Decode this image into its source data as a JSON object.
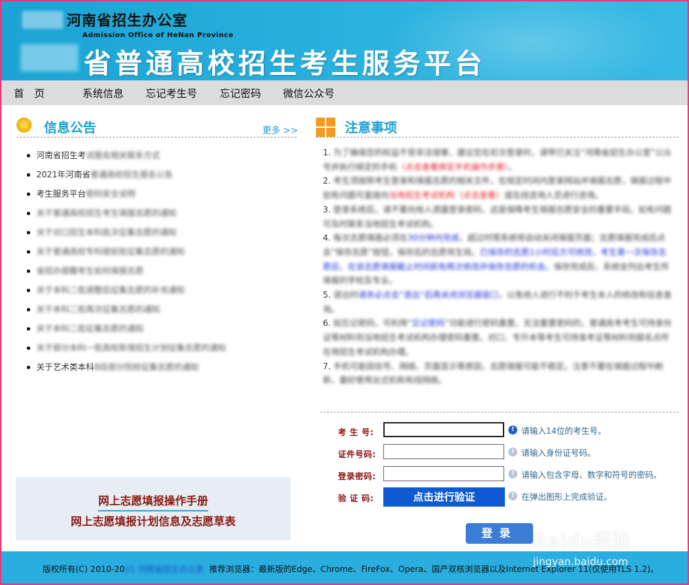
{
  "header": {
    "office_name": "河南省招生办公室",
    "office_name_en": "Admission Office of HeNan Province",
    "platform_title": "省普通高校招生考生服务平台"
  },
  "nav": [
    "首　页",
    "系统信息",
    "忘记考生号",
    "忘记密码",
    "微信公众号"
  ],
  "left": {
    "title": "信息公告",
    "more": "更多 >>",
    "news": [
      {
        "clear": "河南省招生考",
        "blur": "试报名相关联系方式"
      },
      {
        "clear": "2021年河南省",
        "blur": "普通高校招生报名公告"
      },
      {
        "clear": "考生服务平台",
        "blur": "密码安全说明"
      },
      {
        "clear": "",
        "blur": "关于普通高校招生考生填报志愿的通知"
      },
      {
        "clear": "",
        "blur": "关于对口招生本科批次征集志愿的通知"
      },
      {
        "clear": "",
        "blur": "关于普通高校专科提前批征集志愿的通知"
      },
      {
        "clear": "",
        "blur": "省招办提醒考生如何填报志愿"
      },
      {
        "clear": "",
        "blur": "关于本科二批调整后征集志愿的补充通知"
      },
      {
        "clear": "",
        "blur": "关于本科二批再次征集志愿的通知"
      },
      {
        "clear": "",
        "blur": "关于本科二批征集志愿的通知"
      },
      {
        "clear": "",
        "blur": "关于部分本科一批高校新增招生计划征集志愿的通知"
      },
      {
        "clear": "关于艺术类本科",
        "blur": "B段部分院校征集志愿的通知"
      }
    ],
    "manual_link": "网上志愿填报操作手册",
    "plan_link": "网上志愿填报计划信息及志愿草表"
  },
  "right": {
    "title": "注意事项",
    "notes": [
      [
        {
          "c": "1. ",
          "t": "p"
        },
        {
          "c": "为了确保您的权益不受非法侵害，建议您在初次登录时，请带已关注“河南省招生办公室”公众号并执行绑定的手机",
          "t": "b"
        },
        {
          "c": "（点击查看绑定手机操作步骤）",
          "t": "rb"
        },
        {
          "c": "。",
          "t": "b"
        }
      ],
      [
        {
          "c": "2. ",
          "t": "p"
        },
        {
          "c": "考生须按照考生登录和填报志愿的相关文件，在规定时间内登录网站并填报志愿，填报过程中如有问题可直接向",
          "t": "b"
        },
        {
          "c": "当地招生考试机构（点击查看）",
          "t": "rb"
        },
        {
          "c": "或在线咨询人员进行咨询。",
          "t": "b"
        }
      ],
      [
        {
          "c": "3. ",
          "t": "p"
        },
        {
          "c": "登录系统后，请不要向他人透露登录密码，这是保障考生填报志愿安全的重要手段。如有问题可及时联系当地招生考试机构。",
          "t": "b"
        }
      ],
      [
        {
          "c": "4. ",
          "t": "p"
        },
        {
          "c": "每次志愿填报必须在",
          "t": "b"
        },
        {
          "c": "30分钟内完成",
          "t": "bb"
        },
        {
          "c": "，超过时限系统将自动关闭填报页面；志愿填报完成后点击“保存志愿”按钮，保存后的志愿将生效。",
          "t": "b"
        },
        {
          "c": "已保存的志愿1小时后方可修改，考生第一次保存志愿后，在该志愿填报截止时间前有两次修改并保存志愿的机会。",
          "t": "bb"
        },
        {
          "c": "保存完成后，系统会列出考生所填报的学校及专业。",
          "t": "b"
        }
      ],
      [
        {
          "c": "5. ",
          "t": "p"
        },
        {
          "c": "退出时",
          "t": "b"
        },
        {
          "c": "请务必点击“退出”后再关闭浏览器窗口",
          "t": "bb"
        },
        {
          "c": "，以免他人进行不利于考生本人的修改和信息查询。",
          "t": "b"
        }
      ],
      [
        {
          "c": "6. ",
          "t": "p"
        },
        {
          "c": "如忘记密码，可利用“",
          "t": "b"
        },
        {
          "c": "忘记密码",
          "t": "bb"
        },
        {
          "c": "”功能进行密码重置，无法重置密码的，普通高考考生可持身份证等材料到当地招生考试机构办理密码重置。对口、专升本等考生可持准考证等材料到报名点所在地招生考试机构办理。",
          "t": "b"
        }
      ],
      [
        {
          "c": "7. ",
          "t": "p"
        },
        {
          "c": "手机可能因信号、网络、页面显示等原因，志愿填报可能不稳定。注意不要在填报过程中刷新，最好使用台式机和有线网络。",
          "t": "b"
        }
      ]
    ]
  },
  "form": {
    "fields": [
      {
        "label": "考 生 号:",
        "value": "",
        "hint": "请输入14位的考生号。"
      },
      {
        "label": "证件号码:",
        "value": "",
        "hint": "请输入身份证号码。"
      },
      {
        "label": "登录密码:",
        "value": "",
        "hint": "请输入包含字母、数字和符号的密码。"
      }
    ],
    "captcha_label": "验 证 码:",
    "verify_button": "点击进行验证",
    "captcha_hint": "在弹出图形上完成验证。",
    "login_button": "登录"
  },
  "footer": {
    "copyright_prefix": "版权所有(C) 2010-20",
    "copyright_blur": "21 河南省招生办公室",
    "browsers": "推荐浏览器：最新版的Edge、Chrome、FireFox、Opera、国产双核浏览器以及Internet Explorer 11(仅使用TLS 1.2)。"
  },
  "watermark": {
    "brand": "Baidu经验",
    "url": "jingyan.baidu.com"
  },
  "colors": {
    "accent": "#1a9fd5",
    "border": "#e8377a",
    "label": "#8b1410",
    "verify": "#0d5ad3"
  }
}
